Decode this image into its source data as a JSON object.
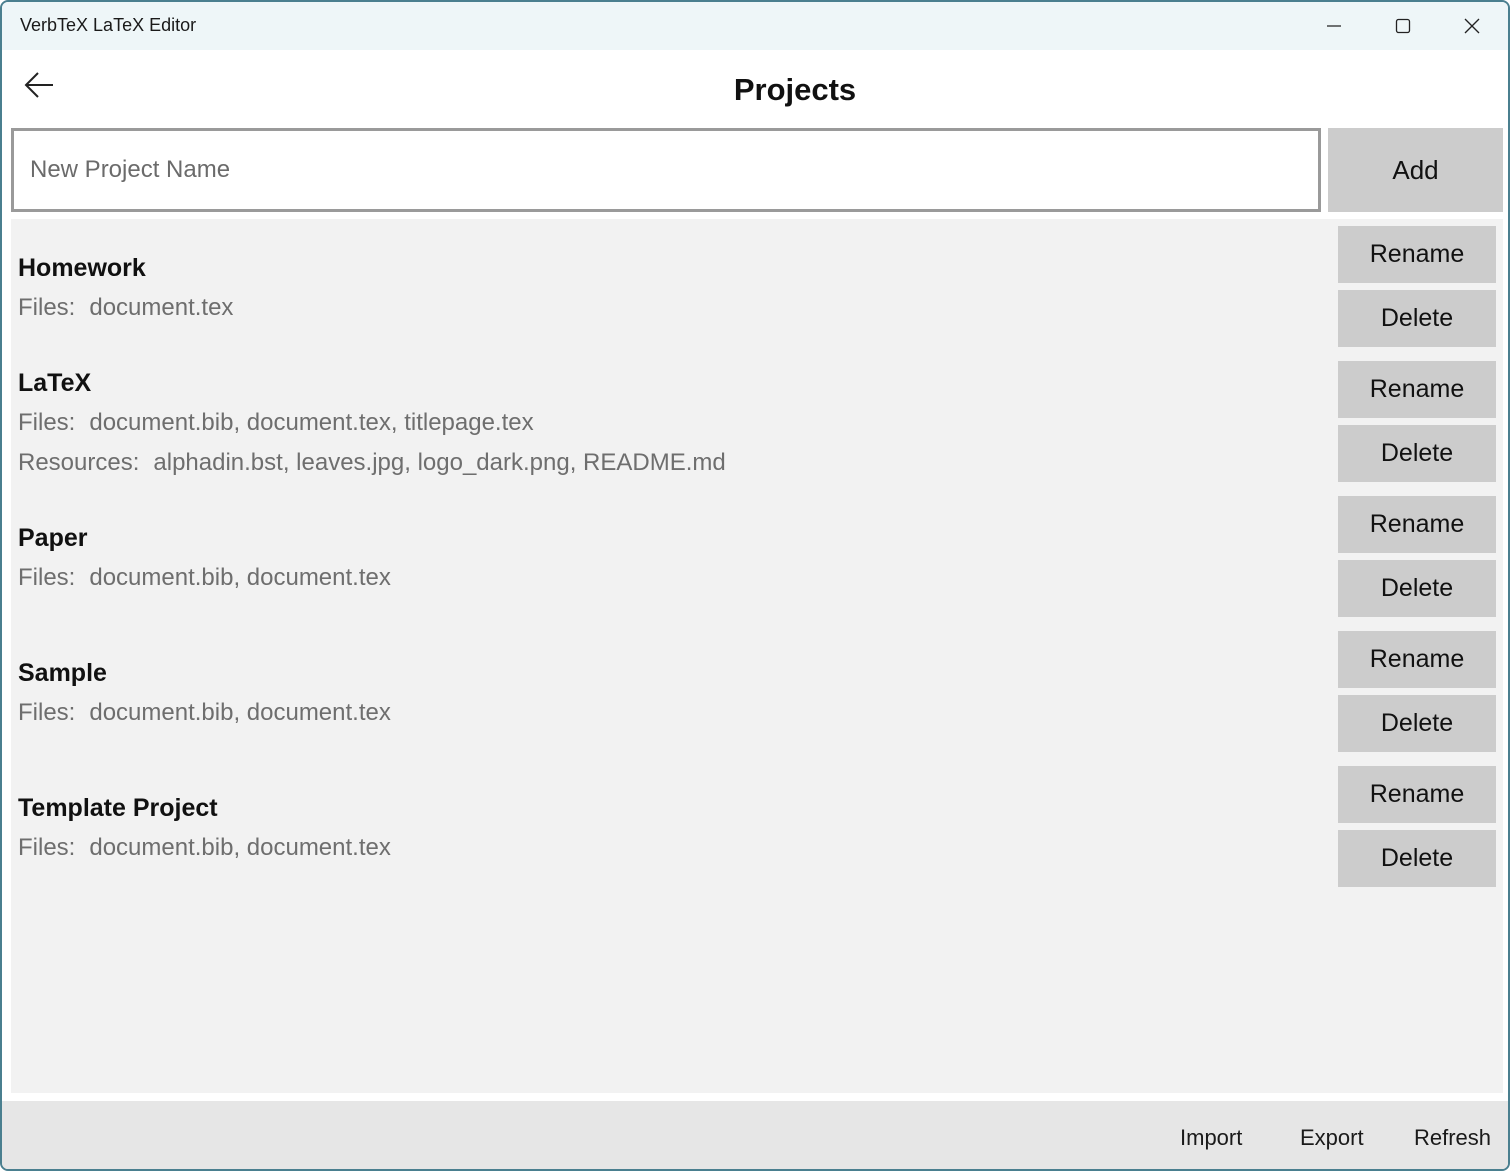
{
  "window": {
    "title": "VerbTeX LaTeX Editor"
  },
  "header": {
    "title": "Projects"
  },
  "new_project": {
    "placeholder": "New Project Name",
    "value": "",
    "add_label": "Add"
  },
  "labels": {
    "files": "Files:",
    "resources": "Resources:",
    "rename": "Rename",
    "delete": "Delete"
  },
  "projects": [
    {
      "name": "Homework",
      "files": "document.tex",
      "resources": ""
    },
    {
      "name": "LaTeX",
      "files": "document.bib, document.tex, titlepage.tex",
      "resources": "alphadin.bst, leaves.jpg, logo_dark.png, README.md"
    },
    {
      "name": "Paper",
      "files": "document.bib, document.tex",
      "resources": ""
    },
    {
      "name": "Sample",
      "files": "document.bib, document.tex",
      "resources": ""
    },
    {
      "name": "Template Project",
      "files": "document.bib, document.tex",
      "resources": ""
    }
  ],
  "bottom_bar": {
    "import_label": "Import",
    "export_label": "Export",
    "refresh_label": "Refresh"
  }
}
